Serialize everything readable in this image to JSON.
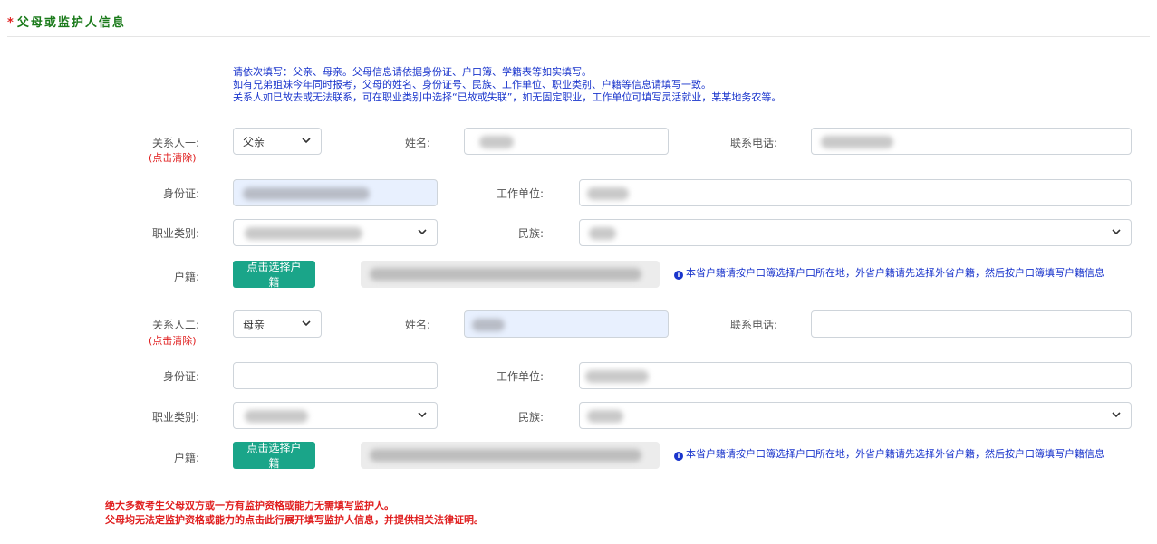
{
  "section": {
    "required_mark": "*",
    "title": "父母或监护人信息"
  },
  "notes": [
    "请依次填写：父亲、母亲。父母信息请依据身份证、户口簿、学籍表等如实填写。",
    "如有兄弟姐妹今年同时报考，父母的姓名、身份证号、民族、工作单位、职业类别、户籍等信息请填写一致。",
    "关系人如已故去或无法联系，可在职业类别中选择“已故或失联”，如无固定职业，工作单位可填写灵活就业，某某地务农等。"
  ],
  "labels": {
    "name": "姓名:",
    "phone": "联系电话:",
    "id_card": "身份证:",
    "work_unit": "工作单位:",
    "occupation": "职业类别:",
    "ethnicity": "民族:",
    "household": "户籍:",
    "clear": "(点击清除)"
  },
  "contact1": {
    "label": "关系人一:",
    "relation": "父亲",
    "household_button": "点击选择户籍"
  },
  "contact2": {
    "label": "关系人二:",
    "relation": "母亲",
    "household_button": "点击选择户籍"
  },
  "household_tip": "本省户籍请按户口簿选择户口所在地，外省户籍请先选择外省户籍，然后按户口簿填写户籍信息",
  "footer": [
    "绝大多数考生父母双方或一方有监护资格或能力无需填写监护人。",
    "父母均无法定监护资格或能力的点击此行展开填写监护人信息，并提供相关法律证明。"
  ],
  "colors": {
    "title": "#1a7a1a",
    "note": "#1a35cc",
    "warn": "#e02020",
    "button": "#1aa589"
  }
}
